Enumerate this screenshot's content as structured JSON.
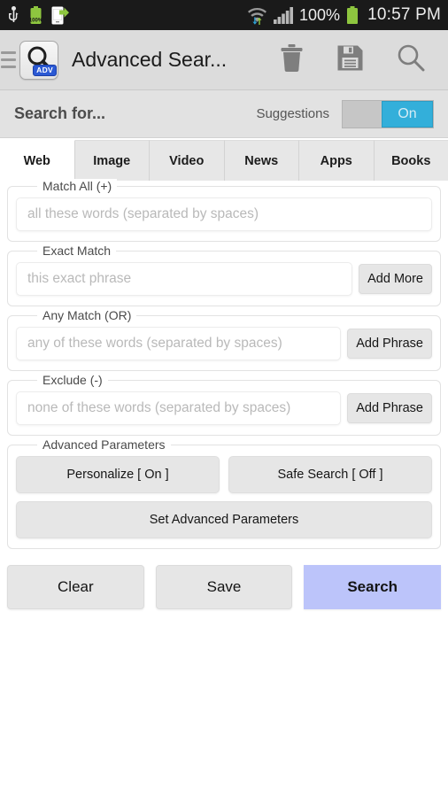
{
  "statusbar": {
    "left_icons": [
      "usb-icon",
      "battery-charging-icon",
      "file-transfer-icon"
    ],
    "battery_label": "100%",
    "right_icons": [
      "wifi-transfer-icon",
      "signal-bars-icon",
      "battery-icon"
    ],
    "battery_percent": "100%",
    "time": "10:57 PM"
  },
  "actionbar": {
    "menu_icon": "hamburger-icon",
    "app_icon": "magnifier-icon",
    "app_icon_badge": "ADV",
    "title": "Advanced Sear...",
    "actions": [
      {
        "name": "delete-icon",
        "label": "Delete"
      },
      {
        "name": "save-icon",
        "label": "Save"
      },
      {
        "name": "search-icon",
        "label": "Search"
      }
    ]
  },
  "searchbar": {
    "label": "Search for...",
    "suggestions_label": "Suggestions",
    "suggestions_state": "On",
    "toggle_on_color": "#33afda",
    "track_color": "#c6c6c6"
  },
  "tabs": [
    {
      "label": "Web",
      "active": true
    },
    {
      "label": "Image",
      "active": false
    },
    {
      "label": "Video",
      "active": false
    },
    {
      "label": "News",
      "active": false
    },
    {
      "label": "Apps",
      "active": false
    },
    {
      "label": "Books",
      "active": false
    }
  ],
  "fields": {
    "match_all": {
      "legend": "Match All (+)",
      "placeholder": "all these words (separated by spaces)",
      "value": "",
      "button": null
    },
    "exact_match": {
      "legend": "Exact Match",
      "placeholder": "this exact phrase",
      "value": "",
      "button": "Add More"
    },
    "any_match": {
      "legend": "Any Match (OR)",
      "placeholder": "any of these words (separated by spaces)",
      "value": "",
      "button": "Add Phrase"
    },
    "exclude": {
      "legend": "Exclude (-)",
      "placeholder": "none of these words (separated by spaces)",
      "value": "",
      "button": "Add Phrase"
    }
  },
  "advanced": {
    "legend": "Advanced Parameters",
    "personalize": "Personalize [ On ]",
    "safe_search": "Safe Search [ Off ]",
    "set_parameters": "Set Advanced Parameters"
  },
  "bottom": {
    "clear": "Clear",
    "save": "Save",
    "search": "Search",
    "search_color": "#bcc4fa"
  }
}
